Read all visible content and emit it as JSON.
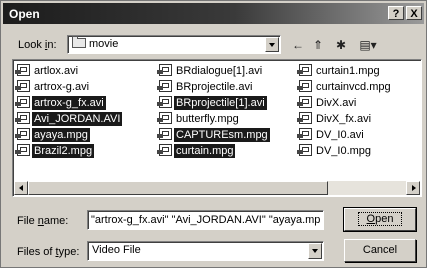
{
  "title": "Open",
  "titlebar_buttons": {
    "help": "?",
    "close": "X"
  },
  "look_in": {
    "label_pre": "Look ",
    "label_key": "i",
    "label_post": "n:",
    "value": "movie"
  },
  "toolbar": {
    "back_glyph": "←",
    "up_glyph": "⇑",
    "new_folder_glyph": "✱",
    "views_glyph": "▤▾"
  },
  "files": [
    {
      "name": "artlox.avi",
      "selected": false
    },
    {
      "name": "artrox-g.avi",
      "selected": false
    },
    {
      "name": "artrox-g_fx.avi",
      "selected": true
    },
    {
      "name": "Avi_JORDAN.AVI",
      "selected": true
    },
    {
      "name": "ayaya.mpg",
      "selected": true
    },
    {
      "name": "Brazil2.mpg",
      "selected": true
    },
    {
      "name": "BRdialogue[1].avi",
      "selected": false
    },
    {
      "name": "BRprojectile.avi",
      "selected": false
    },
    {
      "name": "BRprojectile[1].avi",
      "selected": true
    },
    {
      "name": "butterfly.mpg",
      "selected": false
    },
    {
      "name": "CAPTUREsm.mpg",
      "selected": true
    },
    {
      "name": "curtain.mpg",
      "selected": true
    },
    {
      "name": "curtain1.mpg",
      "selected": false
    },
    {
      "name": "curtainvcd.mpg",
      "selected": false
    },
    {
      "name": "DivX.avi",
      "selected": false
    },
    {
      "name": "DivX_fx.avi",
      "selected": false
    },
    {
      "name": "DV_I0.avi",
      "selected": false
    },
    {
      "name": "DV_I0.mpg",
      "selected": false
    }
  ],
  "file_name": {
    "label_pre": "File ",
    "label_key": "n",
    "label_post": "ame:",
    "value": "\"artrox-g_fx.avi\" \"Avi_JORDAN.AVI\" \"ayaya.mp"
  },
  "files_of_type": {
    "label_pre": "Files of ",
    "label_key": "t",
    "label_post": "ype:",
    "value": "Video File"
  },
  "buttons": {
    "open_key": "O",
    "open_rest": "pen",
    "cancel": "Cancel"
  }
}
